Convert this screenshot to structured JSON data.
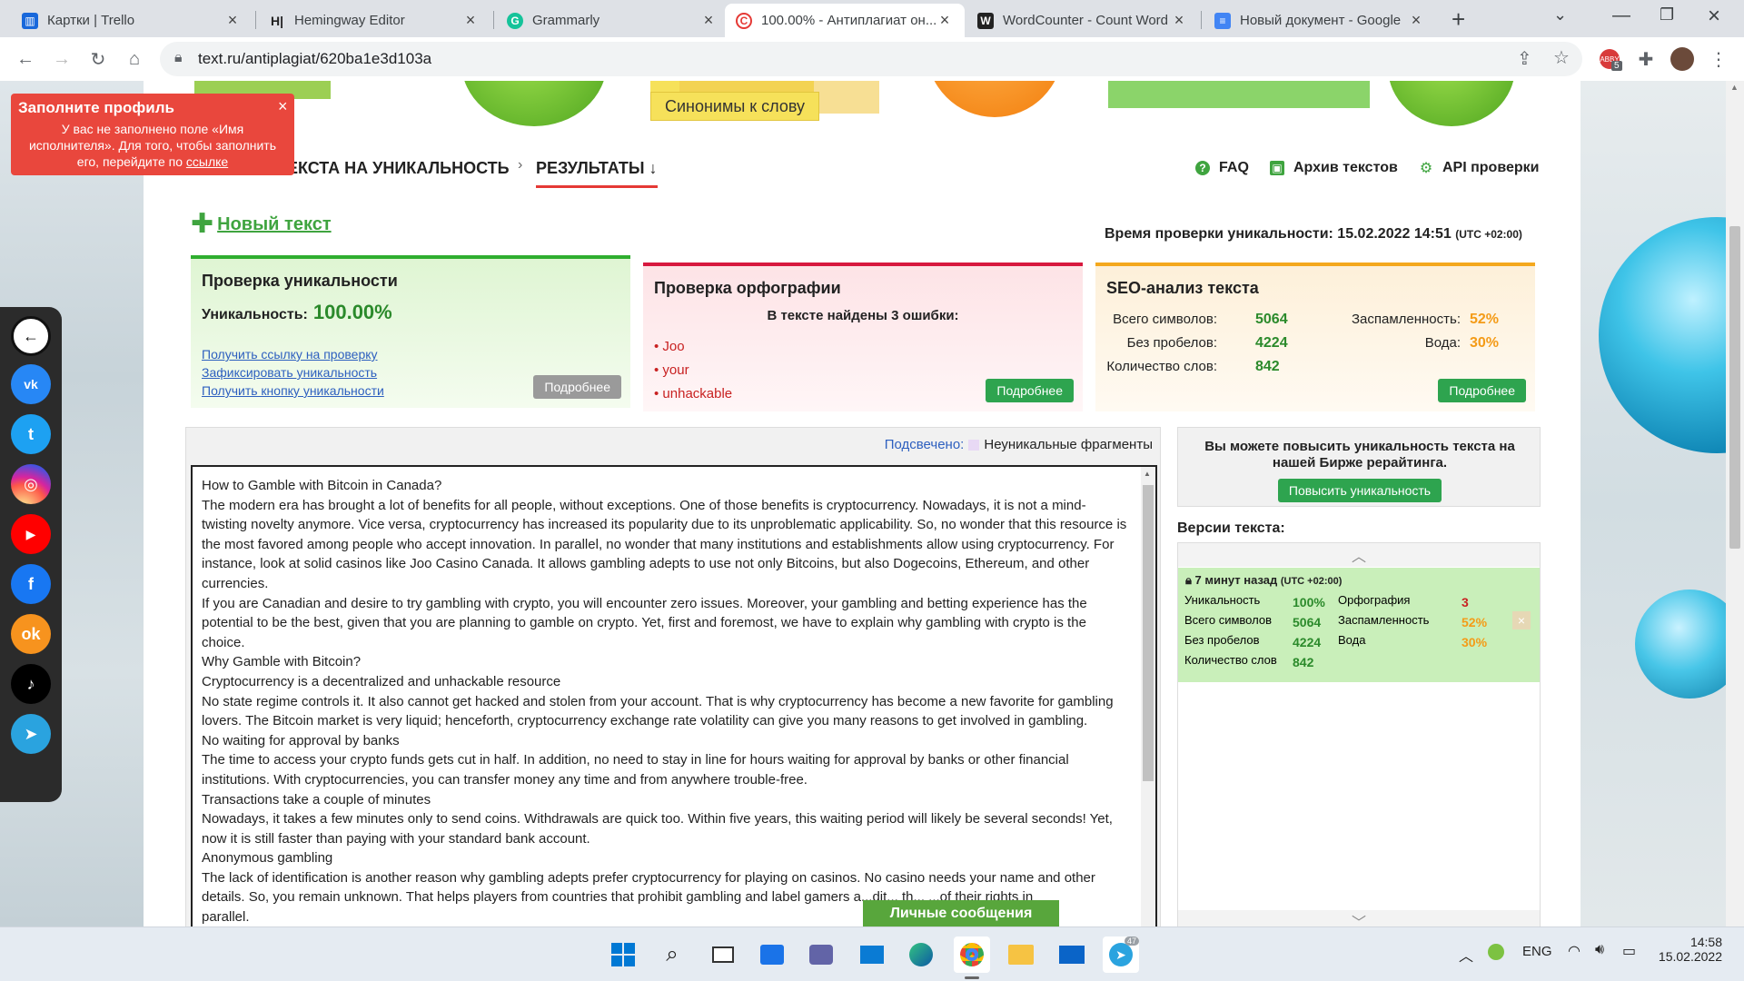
{
  "browser": {
    "tabs": [
      {
        "title": "Картки | Trello",
        "icon": "trello-icon",
        "color": "#1868db",
        "glyph": "▥"
      },
      {
        "title": "Hemingway Editor",
        "icon": "hemingway-icon",
        "color": "#ffffff",
        "glyph": "H|"
      },
      {
        "title": "Grammarly",
        "icon": "grammarly-icon",
        "color": "#15c39a",
        "glyph": "G"
      },
      {
        "title": "100.00% - Антиплагиат он...",
        "icon": "textru-icon",
        "color": "#e53935",
        "glyph": "C",
        "active": true
      },
      {
        "title": "WordCounter - Count Word",
        "icon": "wordcounter-icon",
        "color": "#222222",
        "glyph": "W"
      },
      {
        "title": "Новый документ - Google",
        "icon": "google-docs-icon",
        "color": "#4285f4",
        "glyph": "≡"
      }
    ],
    "new_tab": "+",
    "url": "text.ru/antiplagiat/620ba1e3d103a"
  },
  "banner": {
    "button_sinonimy": "Синонимы к слову"
  },
  "nav": {
    "crumb1": "ЕКСТА НА УНИКАЛЬНОСТЬ",
    "crumb_sep": "›",
    "crumb2": "РЕЗУЛЬТАТЫ ↓",
    "faq": "FAQ",
    "archive": "Архив текстов",
    "api": "API проверки"
  },
  "new_text": "Новый текст",
  "check_time_label": "Время проверки уникальности: 15.02.2022 14:51",
  "check_time_tz": "(UTC +02:00)",
  "uniqueness_card": {
    "title": "Проверка уникальности",
    "label": "Уникальность:",
    "value": "100.00%",
    "links": [
      "Получить ссылку на проверку",
      "Зафиксировать уникальность",
      "Получить кнопку уникальности"
    ],
    "more": "Подробнее"
  },
  "spelling_card": {
    "title": "Проверка орфографии",
    "subtitle": "В тексте найдены 3 ошибки:",
    "errors": [
      "Joo",
      "your",
      "unhackable"
    ],
    "more": "Подробнее"
  },
  "seo_card": {
    "title": "SEO-анализ текста",
    "rows": [
      {
        "label": "Всего символов:",
        "value": "5064",
        "label2": "Заспамленность:",
        "value2": "52%"
      },
      {
        "label": "Без пробелов:",
        "value": "4224",
        "label2": "Вода:",
        "value2": "30%"
      },
      {
        "label": "Количество слов:",
        "value": "842"
      }
    ],
    "more": "Подробнее"
  },
  "highlight": {
    "label": "Подсвечено:",
    "legend": "Неуникальные фрагменты"
  },
  "text_lines": [
    "How to Gamble with Bitcoin in Canada?",
    "The modern era has brought a lot of benefits for all people, without exceptions. One of those benefits is cryptocurrency. Nowadays, it is not a mind-",
    "twisting novelty anymore. Vice versa, cryptocurrency has increased its popularity due to its unproblematic applicability. So, no wonder that this resource is",
    "the most favored among people who accept innovation. In parallel, no wonder that many institutions and establishments allow using cryptocurrency. For",
    "instance, look at solid casinos like Joo Casino Canada. It allows gambling adepts to use not only Bitcoins, but also Dogecoins, Ethereum, and other",
    "currencies.",
    "If you are Canadian and desire to try gambling with crypto, you will encounter zero issues. Moreover, your gambling and betting experience has the",
    "potential to be the best, given that you are planning to gamble on crypto. Yet, first and foremost, we have to explain why gambling with crypto is the",
    "choice.",
    "Why Gamble with Bitcoin?",
    "Cryptocurrency is a decentralized and unhackable resource",
    "No state regime controls it. It also cannot get hacked and stolen from your account. That is why cryptocurrency has become a new favorite for gambling",
    "lovers. The Bitcoin market is very liquid; henceforth, cryptocurrency exchange rate volatility can give you many reasons to get involved in gambling.",
    "No waiting for approval by banks",
    "The time to access your crypto funds gets cut in half. In addition, no need to stay in line for hours waiting for approval by banks or other financial",
    "institutions. With cryptocurrencies, you can transfer money any time and from anywhere trouble-free.",
    "Transactions take a couple of minutes",
    "Nowadays, it takes a few minutes only to send coins. Withdrawals are quick too. Within five years, this waiting period will likely be several seconds! Yet,",
    "now it is still faster than paying with your standard bank account.",
    "Anonymous gambling",
    "The lack of identification is another reason why gambling adepts prefer cryptocurrency for playing on casinos. No casino needs your name and other",
    "details. So, you remain unknown. That helps players from countries that prohibit gambling and label gamers a...dit... th... ...of their rights in",
    "parallel."
  ],
  "boost": {
    "text": "Вы можете повысить уникальность текста на нашей Бирже рерайтинга.",
    "button": "Повысить уникальность"
  },
  "versions": {
    "title": "Версии текста:",
    "entry": {
      "time": "7 минут назад",
      "tz": "(UTC +02:00)",
      "rows": [
        {
          "l1": "Уникальность",
          "v1": "100%",
          "l2": "Орфография",
          "v2": "3"
        },
        {
          "l1": "Всего символов",
          "v1": "5064",
          "l2": "Заспамленность",
          "v2": "52%"
        },
        {
          "l1": "Без пробелов",
          "v1": "4224",
          "l2": "Вода",
          "v2": "30%"
        },
        {
          "l1": "Количество слов",
          "v1": "842"
        }
      ]
    }
  },
  "messages_button": "Личные сообщения",
  "notification": {
    "title": "Заполните профиль",
    "body": "У вас не заполнено поле «Имя исполнителя». Для того, чтобы заполнить его, перейдите по",
    "link": "ссылке",
    "close": "×"
  },
  "social": [
    "back-icon",
    "vk-icon",
    "twitter-icon",
    "instagram-icon",
    "youtube-icon",
    "facebook-icon",
    "odnoklassniki-icon",
    "tiktok-icon",
    "telegram-icon"
  ],
  "taskbar": {
    "lang": "ENG",
    "time": "14:58",
    "date": "15.02.2022",
    "telegram_badge": "47",
    "ext_badge": "5"
  }
}
